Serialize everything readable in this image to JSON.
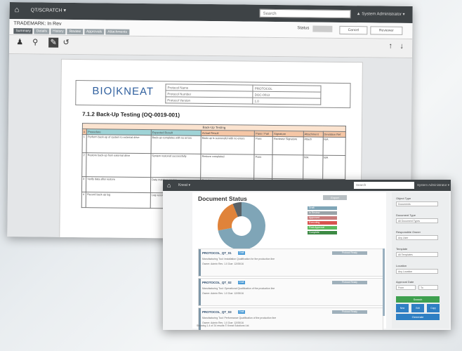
{
  "back_window": {
    "brand": "QT/SCRATCH ▾",
    "search_placeholder": "Search",
    "user": "▲ System Administrator ▾",
    "doc_title": "TRADEMARK: In Rev",
    "tabs": [
      "Summary",
      "Details",
      "History",
      "Review",
      "Approvals",
      "Attachments"
    ],
    "state_label": "Status",
    "buttons": [
      "Cancel",
      "Reviewer"
    ],
    "doc_logo": "BIO|KNEAT",
    "meta_labels": [
      "Protocol Name",
      "Protocol Number",
      "Protocol Version"
    ],
    "meta_values": [
      "PROTOCOL",
      "DOC-0013",
      "1.0"
    ],
    "section_title": "7.1.2 Back-Up Testing (OQ-0019-001)",
    "table_caption": "Back-Up Testing",
    "table_headers": [
      "#",
      "Procedure",
      "Expected Result",
      "Actual Result",
      "Pass / Fail",
      "Signature",
      "Attachment",
      "Deviation Ref"
    ],
    "rows": [
      [
        "1",
        "Perform back-up of system to external drive",
        "Back-up completes with no errors",
        "Back-up is successful with no errors",
        "Pass",
        "Reviewer Signature",
        "Attach",
        "N/A"
      ],
      [
        "2",
        "Restore back-up from external drive",
        "System restored successfully",
        "Restore completed",
        "Pass",
        "",
        "N/A",
        "N/A"
      ],
      [
        "3",
        "Verify data after restore",
        "Data matches source",
        "Complete",
        "Pass",
        "",
        "N/A",
        "N/A"
      ],
      [
        "4",
        "Record back-up log",
        "Log recorded",
        "Recorded",
        "Pass",
        "",
        "N/A",
        "N/A"
      ]
    ]
  },
  "front_window": {
    "brand": "Kneat ▾",
    "search_placeholder": "Search",
    "user": "System Administrator ▾",
    "title": "Document Status",
    "export_label": "Export",
    "chart_legend": [
      {
        "label": "Draft",
        "color": "#7fa5b7"
      },
      {
        "label": "In Review",
        "color": "#9aa3a8"
      },
      {
        "label": "Approved",
        "color": "#c77d7d"
      },
      {
        "label": "Executing",
        "color": "#d9534f"
      },
      {
        "label": "Post-Approval",
        "color": "#5cb85c"
      },
      {
        "label": "Complete",
        "color": "#3d8a45"
      }
    ],
    "documents": [
      {
        "name": "PROTOCOL_QT_01",
        "badge": "Draft",
        "status": "Protocol Ready",
        "line1": "Manufacturing Tool: Installation Qualification for the production line",
        "line2": "Owner: Admin   Rev: 1.0   Due: 12/05/16"
      },
      {
        "name": "PROTOCOL_QT_02",
        "badge": "Draft",
        "status": "Protocol Ready",
        "line1": "Manufacturing Tool: Operational Qualification of the production line",
        "line2": "Owner: Admin   Rev: 1.0   Due: 12/05/16"
      },
      {
        "name": "PROTOCOL_QT_03",
        "badge": "Draft",
        "status": "Protocol Ready",
        "line1": "Manufacturing Tool: Performance Qualification of the production line",
        "line2": "Owner: Admin   Rev: 1.0   Due: 12/05/16"
      },
      {
        "name": "PROTOCOL_QT_04",
        "badge": "Draft",
        "status": "Protocol Ready",
        "line1": "Manufacturing Tool: Back-up and Restore Testing",
        "line2": "Owner: Admin   Rev: 1.0   Due: 12/05/16"
      }
    ],
    "footer": "Showing 1-4 of 24 results   © Kneat Solutions Ltd.",
    "filters": [
      {
        "label": "Object Type",
        "value": "Documents"
      },
      {
        "label": "Document Type",
        "value": "All Document Types"
      },
      {
        "label": "Responsible Owner",
        "value": "Any User"
      },
      {
        "label": "Template",
        "value": "All Templates"
      },
      {
        "label": "Location",
        "value": "Any Location"
      }
    ],
    "due_label": "Approval Date",
    "due_from": "From",
    "due_to": "To",
    "search_button": "Search",
    "icon_buttons": [
      "New",
      "Edit",
      "Copy"
    ],
    "bottom_button": "Generate"
  },
  "chart_data": {
    "type": "pie",
    "title": "",
    "categories": [
      "Draft",
      "In Review",
      "Executing"
    ],
    "values": [
      72,
      22,
      6
    ],
    "colors": [
      "#7fa5b7",
      "#e0833a",
      "#5a6166"
    ],
    "donut": true
  }
}
